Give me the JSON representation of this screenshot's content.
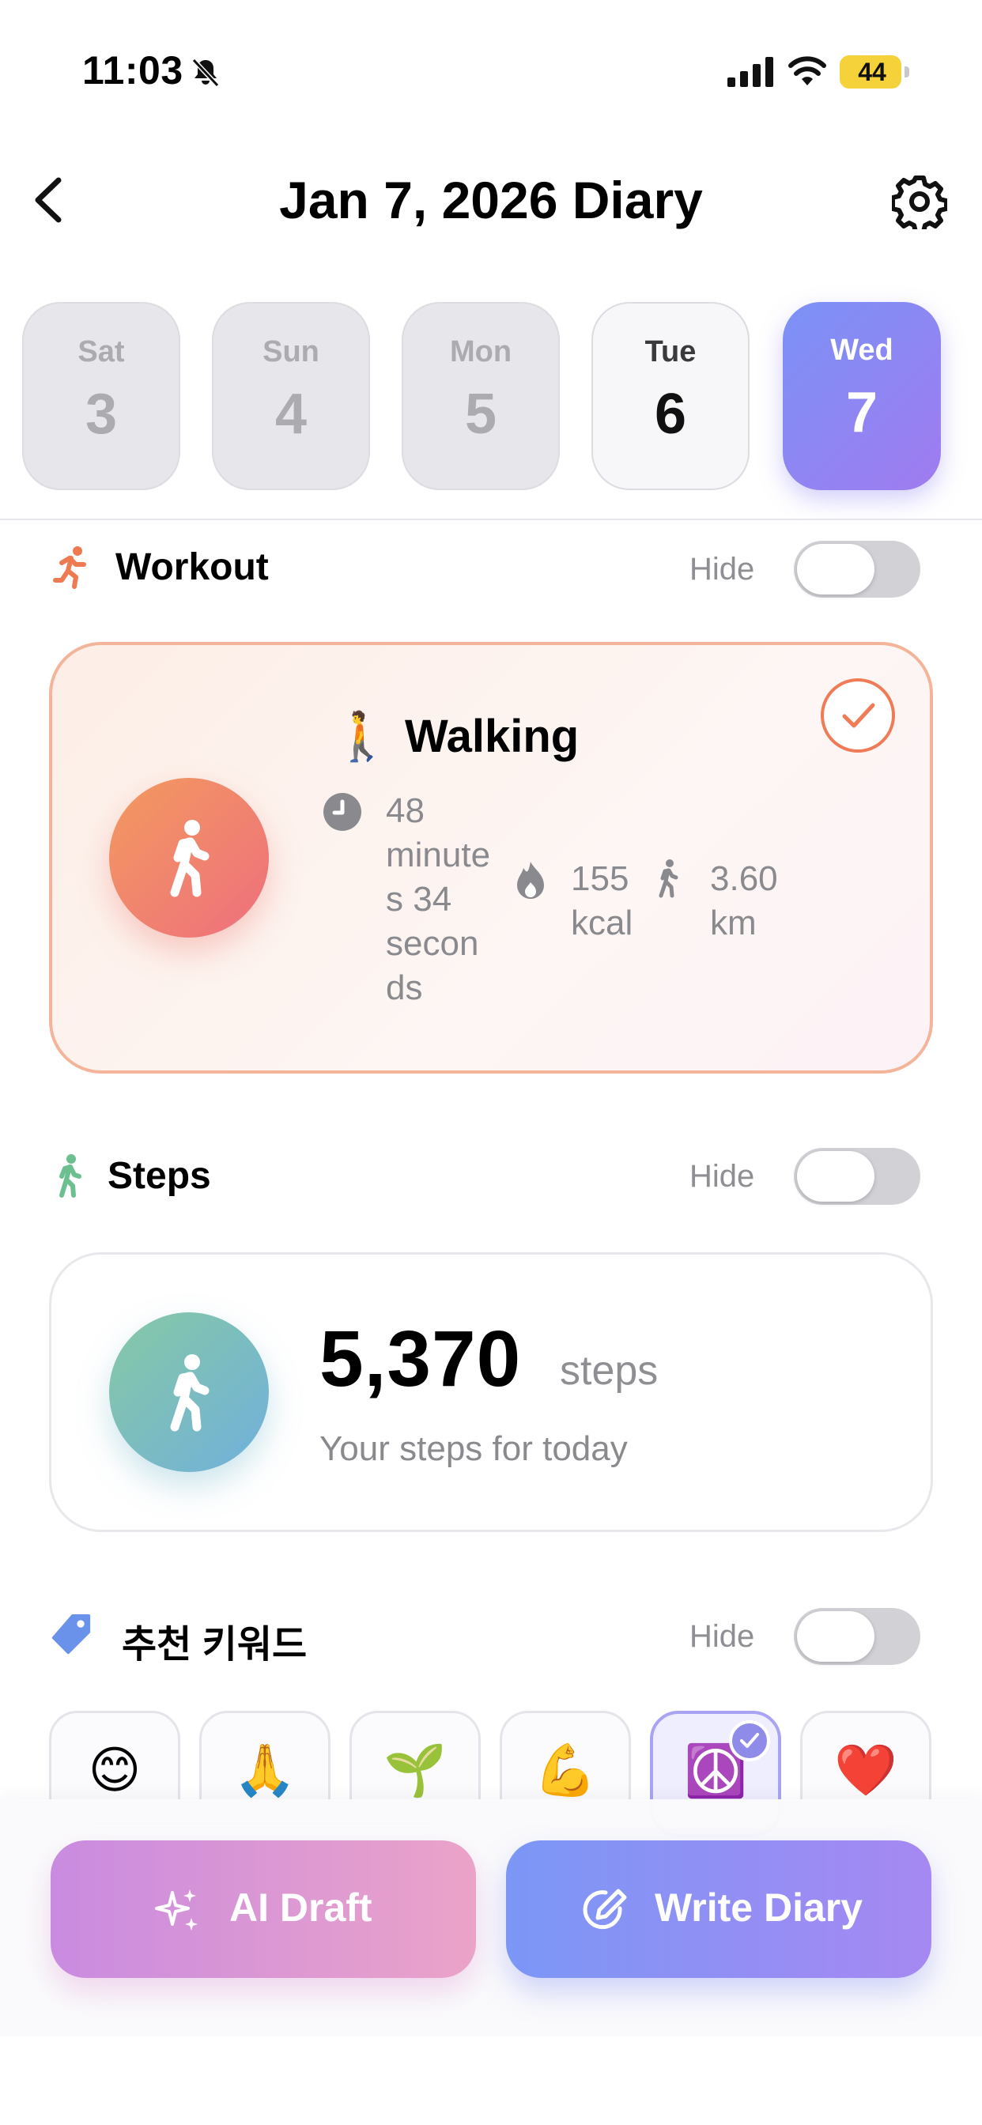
{
  "status_bar": {
    "time": "11:03",
    "battery": "44"
  },
  "header": {
    "title": "Jan 7, 2026 Diary"
  },
  "days": [
    {
      "name": "Sat",
      "num": "3"
    },
    {
      "name": "Sun",
      "num": "4"
    },
    {
      "name": "Mon",
      "num": "5"
    },
    {
      "name": "Tue",
      "num": "6"
    },
    {
      "name": "Wed",
      "num": "7"
    }
  ],
  "workout": {
    "section_label": "Workout",
    "hide_label": "Hide",
    "emoji": "🚶",
    "name": "Walking",
    "duration_lines": [
      "48",
      "minute",
      "s 34",
      "secon",
      "ds"
    ],
    "calories_lines": [
      "155",
      "kcal"
    ],
    "distance_lines": [
      "3.60",
      "km"
    ]
  },
  "steps": {
    "section_label": "Steps",
    "hide_label": "Hide",
    "count": "5,370",
    "unit": "steps",
    "caption": "Your steps for today"
  },
  "keywords": {
    "section_label": "추천 키워드",
    "hide_label": "Hide",
    "chips": [
      "😊",
      "🙏",
      "🌱",
      "💪",
      "☮️",
      "❤️"
    ],
    "selected_index": 4
  },
  "actions": {
    "ai_draft": "AI Draft",
    "write_diary": "Write Diary"
  },
  "colors": {
    "accent_purple": "#8f86f0",
    "workout_orange": "#ef7b57",
    "toggle_off": "#d1d1d6"
  }
}
